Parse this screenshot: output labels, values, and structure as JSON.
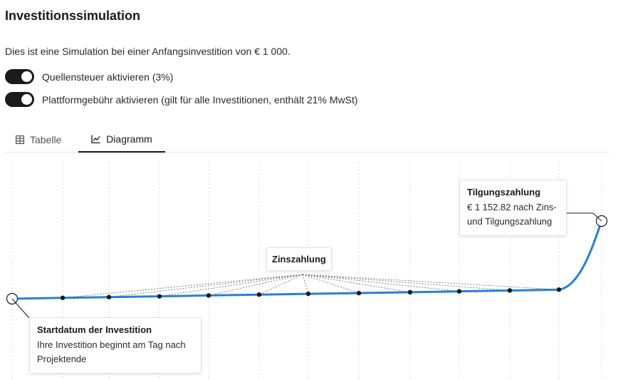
{
  "page": {
    "title": "Investitionssimulation",
    "description": "Dies ist eine Simulation bei einer Anfangsinvestition von € 1 000."
  },
  "toggles": [
    {
      "label": "Quellensteuer aktivieren (3%)",
      "checked": true
    },
    {
      "label": "Plattformgebühr aktivieren (gilt für alle Investitionen, enthält 21% MwSt)",
      "checked": true
    }
  ],
  "tabs": {
    "table": {
      "label": "Tabelle",
      "icon": "table-icon",
      "active": false
    },
    "chart": {
      "label": "Diagramm",
      "icon": "line-chart-icon",
      "active": true
    }
  },
  "chart_data": {
    "type": "line",
    "line_color": "#2a7fd4",
    "grid": "vertical-dotted",
    "x": [
      0,
      1,
      2,
      3,
      4,
      5,
      6,
      7,
      8,
      9,
      10,
      11,
      12
    ],
    "y": [
      1000,
      1001.7,
      1003.2,
      1004.7,
      1006.4,
      1008.1,
      1009.6,
      1011.1,
      1012.8,
      1014.5,
      1016.2,
      1017.9,
      1152.82
    ]
  },
  "annotations": {
    "start": {
      "title": "Startdatum der Investition",
      "body": "Ihre Investition beginnt am Tag nach Projektende"
    },
    "interest": {
      "title": "Zinszahlung"
    },
    "repayment": {
      "title": "Tilgungszahlung",
      "body": "€ 1 152.82 nach Zins- und Tilgungszahlung"
    }
  }
}
